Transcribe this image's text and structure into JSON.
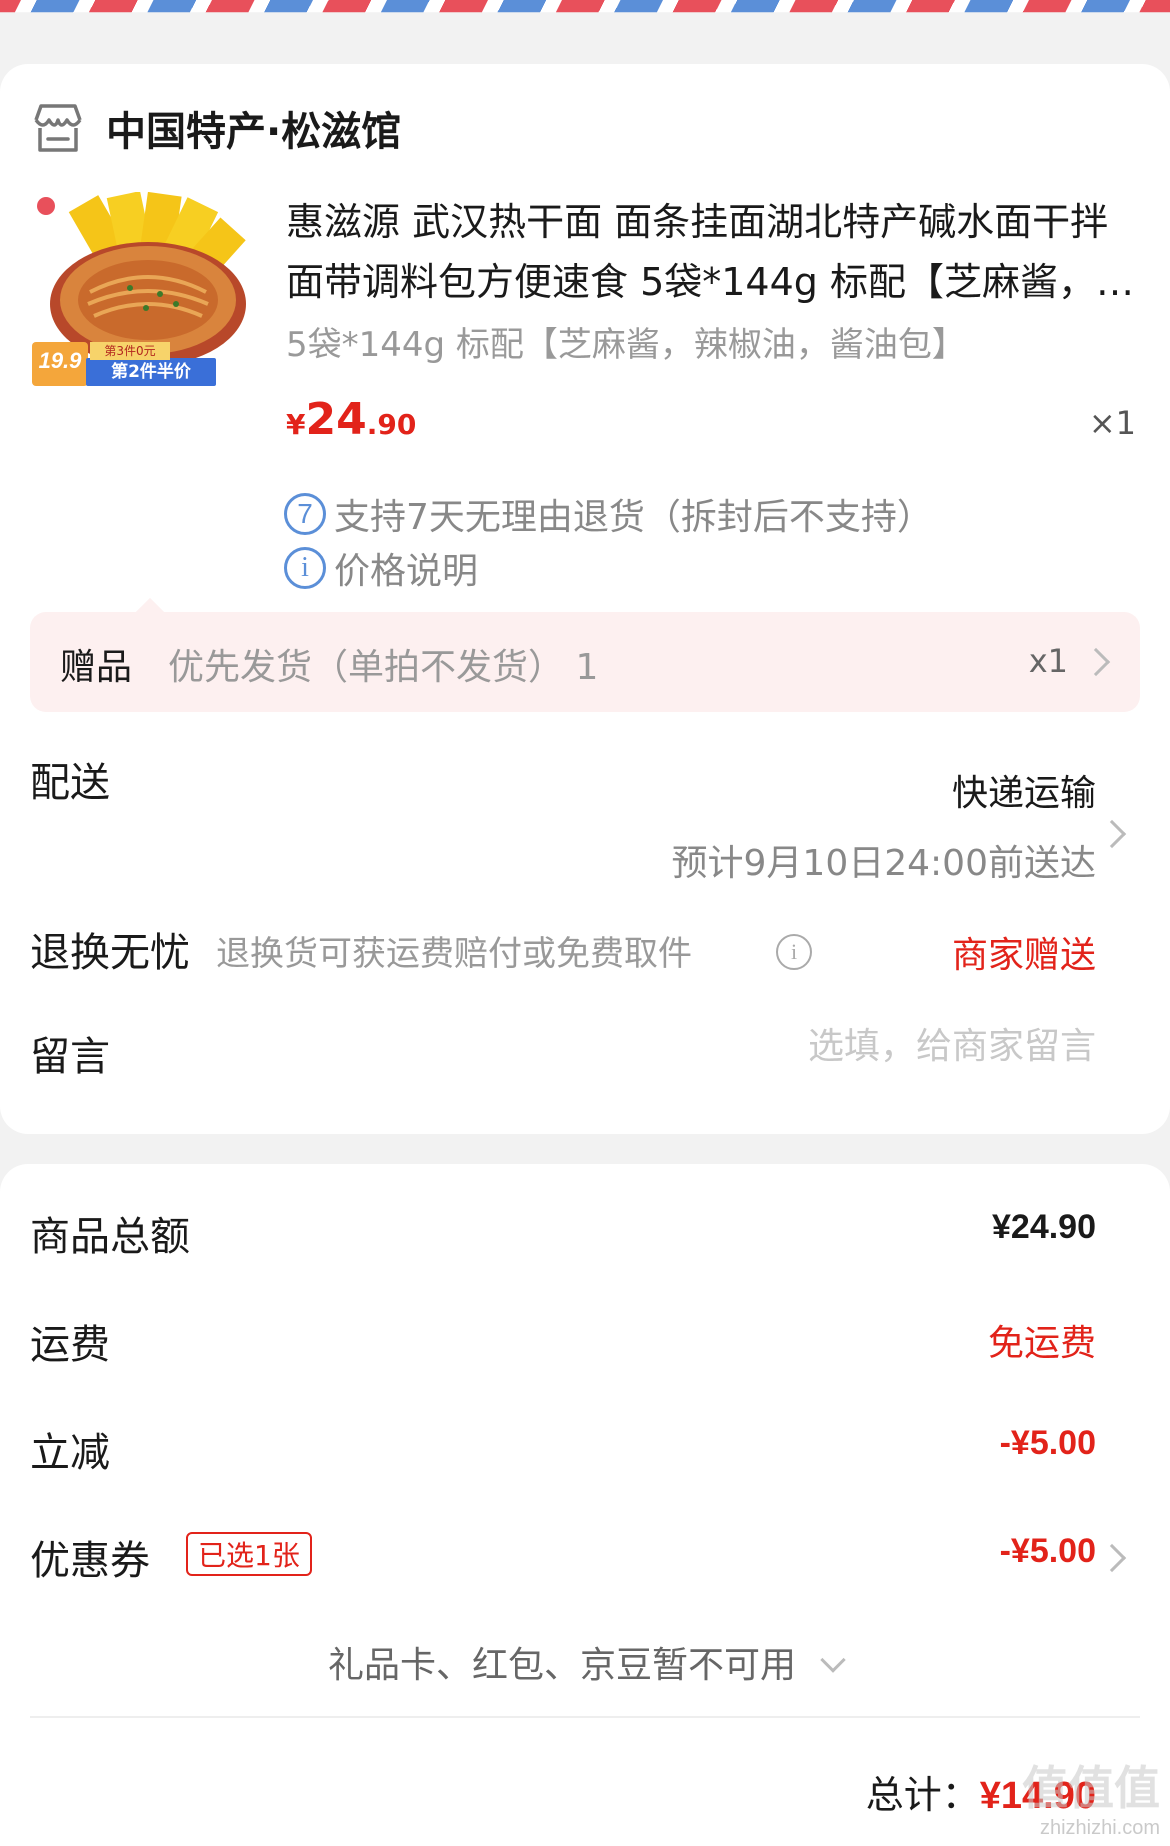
{
  "colors": {
    "accent": "#e2231a",
    "info_blue": "#5b8fd8",
    "muted": "#999999",
    "gift_bg": "#fdf0f0"
  },
  "shop": {
    "name": "中国特产·松滋馆",
    "icon": "store-icon"
  },
  "product": {
    "title": "惠滋源 武汉热干面 面条挂面湖北特产碱水面干拌面带调料包方便速食 5袋*144g 标配【芝麻酱，辣椒油，酱油包】",
    "spec": "5袋*144g 标配【芝麻酱，辣椒油，酱油包】",
    "price_symbol": "¥",
    "price_int": "24",
    "price_dec": ".90",
    "quantity": "×1",
    "thumb": {
      "badge_price": "19.9",
      "badge_top": "第3件0元",
      "badge_main": "第2件半价"
    }
  },
  "services": [
    {
      "icon_text": "7",
      "icon": "seven-day-icon",
      "text": "支持7天无理由退货（拆封后不支持）"
    },
    {
      "icon_text": "i",
      "icon": "info-icon",
      "text": "价格说明"
    }
  ],
  "gift": {
    "label": "赠品",
    "text": "优先发货（单拍不发货） 1",
    "quantity": "x1"
  },
  "delivery": {
    "label": "配送",
    "method": "快递运输",
    "eta": "预计9月10日24:00前送达"
  },
  "return": {
    "label": "退换无忧",
    "desc": "退换货可获运费赔付或免费取件",
    "value": "商家赠送"
  },
  "message": {
    "label": "留言",
    "placeholder": "选填，给商家留言"
  },
  "summary": {
    "goods_label": "商品总额",
    "goods_value": "¥24.90",
    "shipping_label": "运费",
    "shipping_value": "免运费",
    "discount_label": "立减",
    "discount_value": "-¥5.00",
    "coupon_label": "优惠券",
    "coupon_badge": "已选1张",
    "coupon_value": "-¥5.00",
    "unavailable": "礼品卡、红包、京豆暂不可用",
    "total_label": "总计：",
    "total_value": "¥14.90"
  },
  "watermark": {
    "site": "zhizhizhi.com",
    "brand": "值值值"
  }
}
